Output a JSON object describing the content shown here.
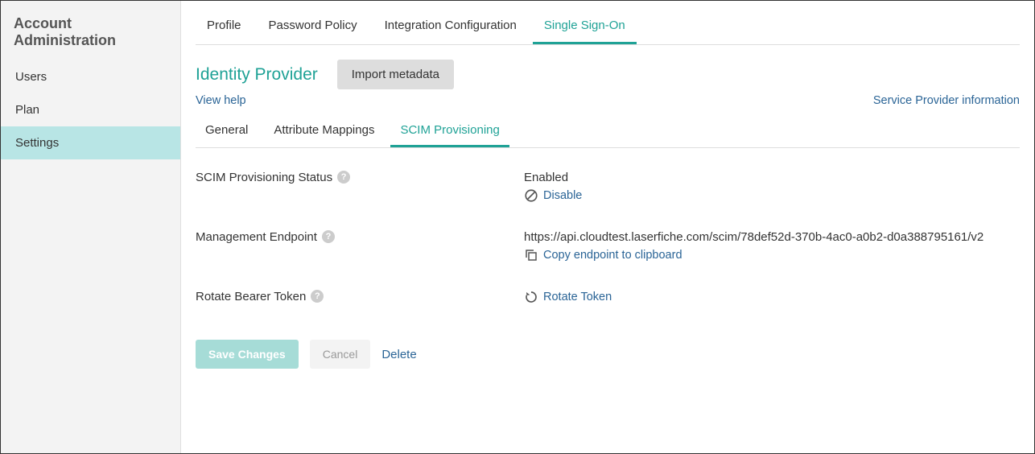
{
  "sidebar": {
    "title": "Account Administration",
    "items": [
      "Users",
      "Plan",
      "Settings"
    ],
    "activeIndex": 2
  },
  "topTabs": {
    "items": [
      "Profile",
      "Password Policy",
      "Integration Configuration",
      "Single Sign-On"
    ],
    "activeIndex": 3
  },
  "section": {
    "title": "Identity Provider",
    "importLabel": "Import metadata",
    "viewHelp": "View help",
    "serviceProviderInfo": "Service Provider information"
  },
  "subTabs": {
    "items": [
      "General",
      "Attribute Mappings",
      "SCIM Provisioning"
    ],
    "activeIndex": 2
  },
  "scim": {
    "statusLabel": "SCIM Provisioning Status",
    "statusValue": "Enabled",
    "disableLabel": "Disable",
    "endpointLabel": "Management Endpoint",
    "endpointValue": "https://api.cloudtest.laserfiche.com/scim/78def52d-370b-4ac0-a0b2-d0a388795161/v2",
    "copyLabel": "Copy endpoint to clipboard",
    "rotateLabel": "Rotate Bearer Token",
    "rotateAction": "Rotate Token"
  },
  "footer": {
    "save": "Save Changes",
    "cancel": "Cancel",
    "delete": "Delete"
  }
}
